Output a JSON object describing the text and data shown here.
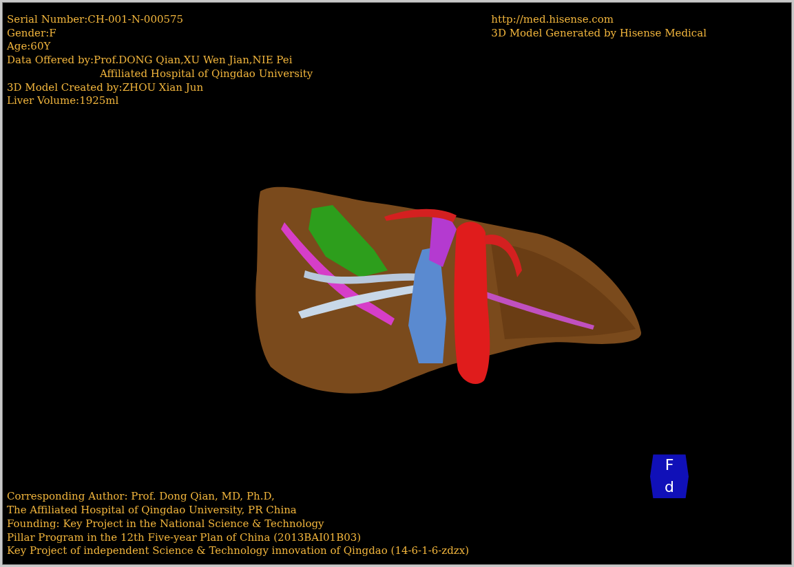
{
  "header_left": [
    {
      "text": "Serial Number:CH-001-N-000575",
      "kind": "plain"
    },
    {
      "text": "Gender:F",
      "kind": "plain"
    },
    {
      "text": "Age:60Y",
      "kind": "plain"
    },
    {
      "text": "Data Offered by:Prof.DONG Qian,XU Wen Jian,NIE Pei",
      "kind": "plain"
    },
    {
      "text": "Affiliated Hospital of Qingdao University",
      "kind": "indented"
    },
    {
      "text": "3D Model Created by:ZHOU Xian Jun",
      "kind": "plain"
    },
    {
      "text": "Liver Volume:1925ml",
      "kind": "plain"
    }
  ],
  "header_right": [
    "http://med.hisense.com",
    "3D Model Generated by Hisense Medical"
  ],
  "footer": [
    "Corresponding Author: Prof. Dong Qian, MD, Ph.D,",
    "The Affiliated Hospital of Qingdao University, PR China",
    "Founding: Key Project in the National Science & Technology",
    "Pillar Program in the 12th Five-year Plan of China (2013BAI01B03)",
    "Key Project of independent Science & Technology innovation of Qingdao (14-6-1-6-zdzx)"
  ],
  "orientation_cube": {
    "top": "F",
    "bottom": "d"
  }
}
